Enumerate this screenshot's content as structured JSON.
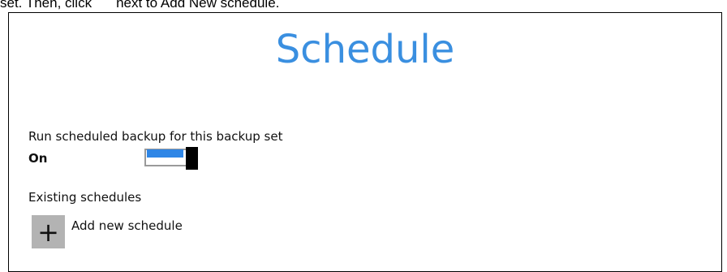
{
  "caption": {
    "prefix": "set. Then, click",
    "suffix": "next to Add New schedule."
  },
  "panel": {
    "title": "Schedule",
    "run_scheduled_label": "Run scheduled backup for this backup set",
    "toggle_state_label": "On",
    "toggle_on": true,
    "existing_schedules_label": "Existing schedules",
    "add_button_icon": "+",
    "add_new_label": "Add new schedule"
  },
  "colors": {
    "title": "#3a8fe0",
    "toggle_fill": "#2f86e6",
    "add_button_bg": "#b3b3b3"
  }
}
